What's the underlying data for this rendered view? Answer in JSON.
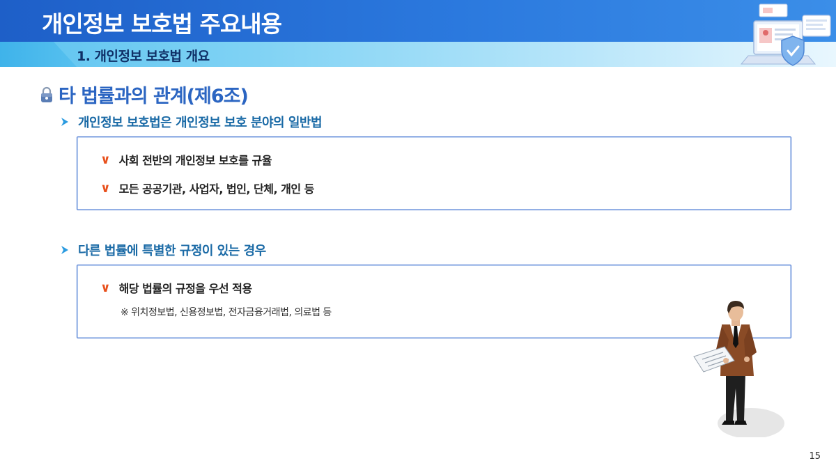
{
  "header": {
    "title": "개인정보 보호법 주요내용",
    "subtitle": "1. 개인정보 보호법 개요"
  },
  "section": {
    "title": "타 법률과의 관계(제6조)"
  },
  "blocks": [
    {
      "heading": "개인정보 보호법은 개인정보 보호 분야의 일반법",
      "items": [
        "사회 전반의 개인정보 보호를 규율",
        "모든 공공기관, 사업자, 법인, 단체, 개인 등"
      ],
      "note": ""
    },
    {
      "heading": "다른 법률에 특별한 규정이 있는 경우",
      "items": [
        "해당 법률의 규정을 우선 적용"
      ],
      "note": "※ 위치정보법, 신용정보법, 전자금융거래법, 의료법 등"
    }
  ],
  "check_glyph": "∨",
  "page_number": "15",
  "colors": {
    "header_blue": "#2b79de",
    "sub_band": "#7fd2f4",
    "section_title": "#2b65c2",
    "bullet_text": "#1a6aa6",
    "check": "#e8501c",
    "box_border": "#3e6fd0"
  },
  "icons": [
    "lock-icon",
    "chevron-right-icon",
    "checkmark-icon",
    "laptop-shield-illustration",
    "businessman-illustration"
  ]
}
